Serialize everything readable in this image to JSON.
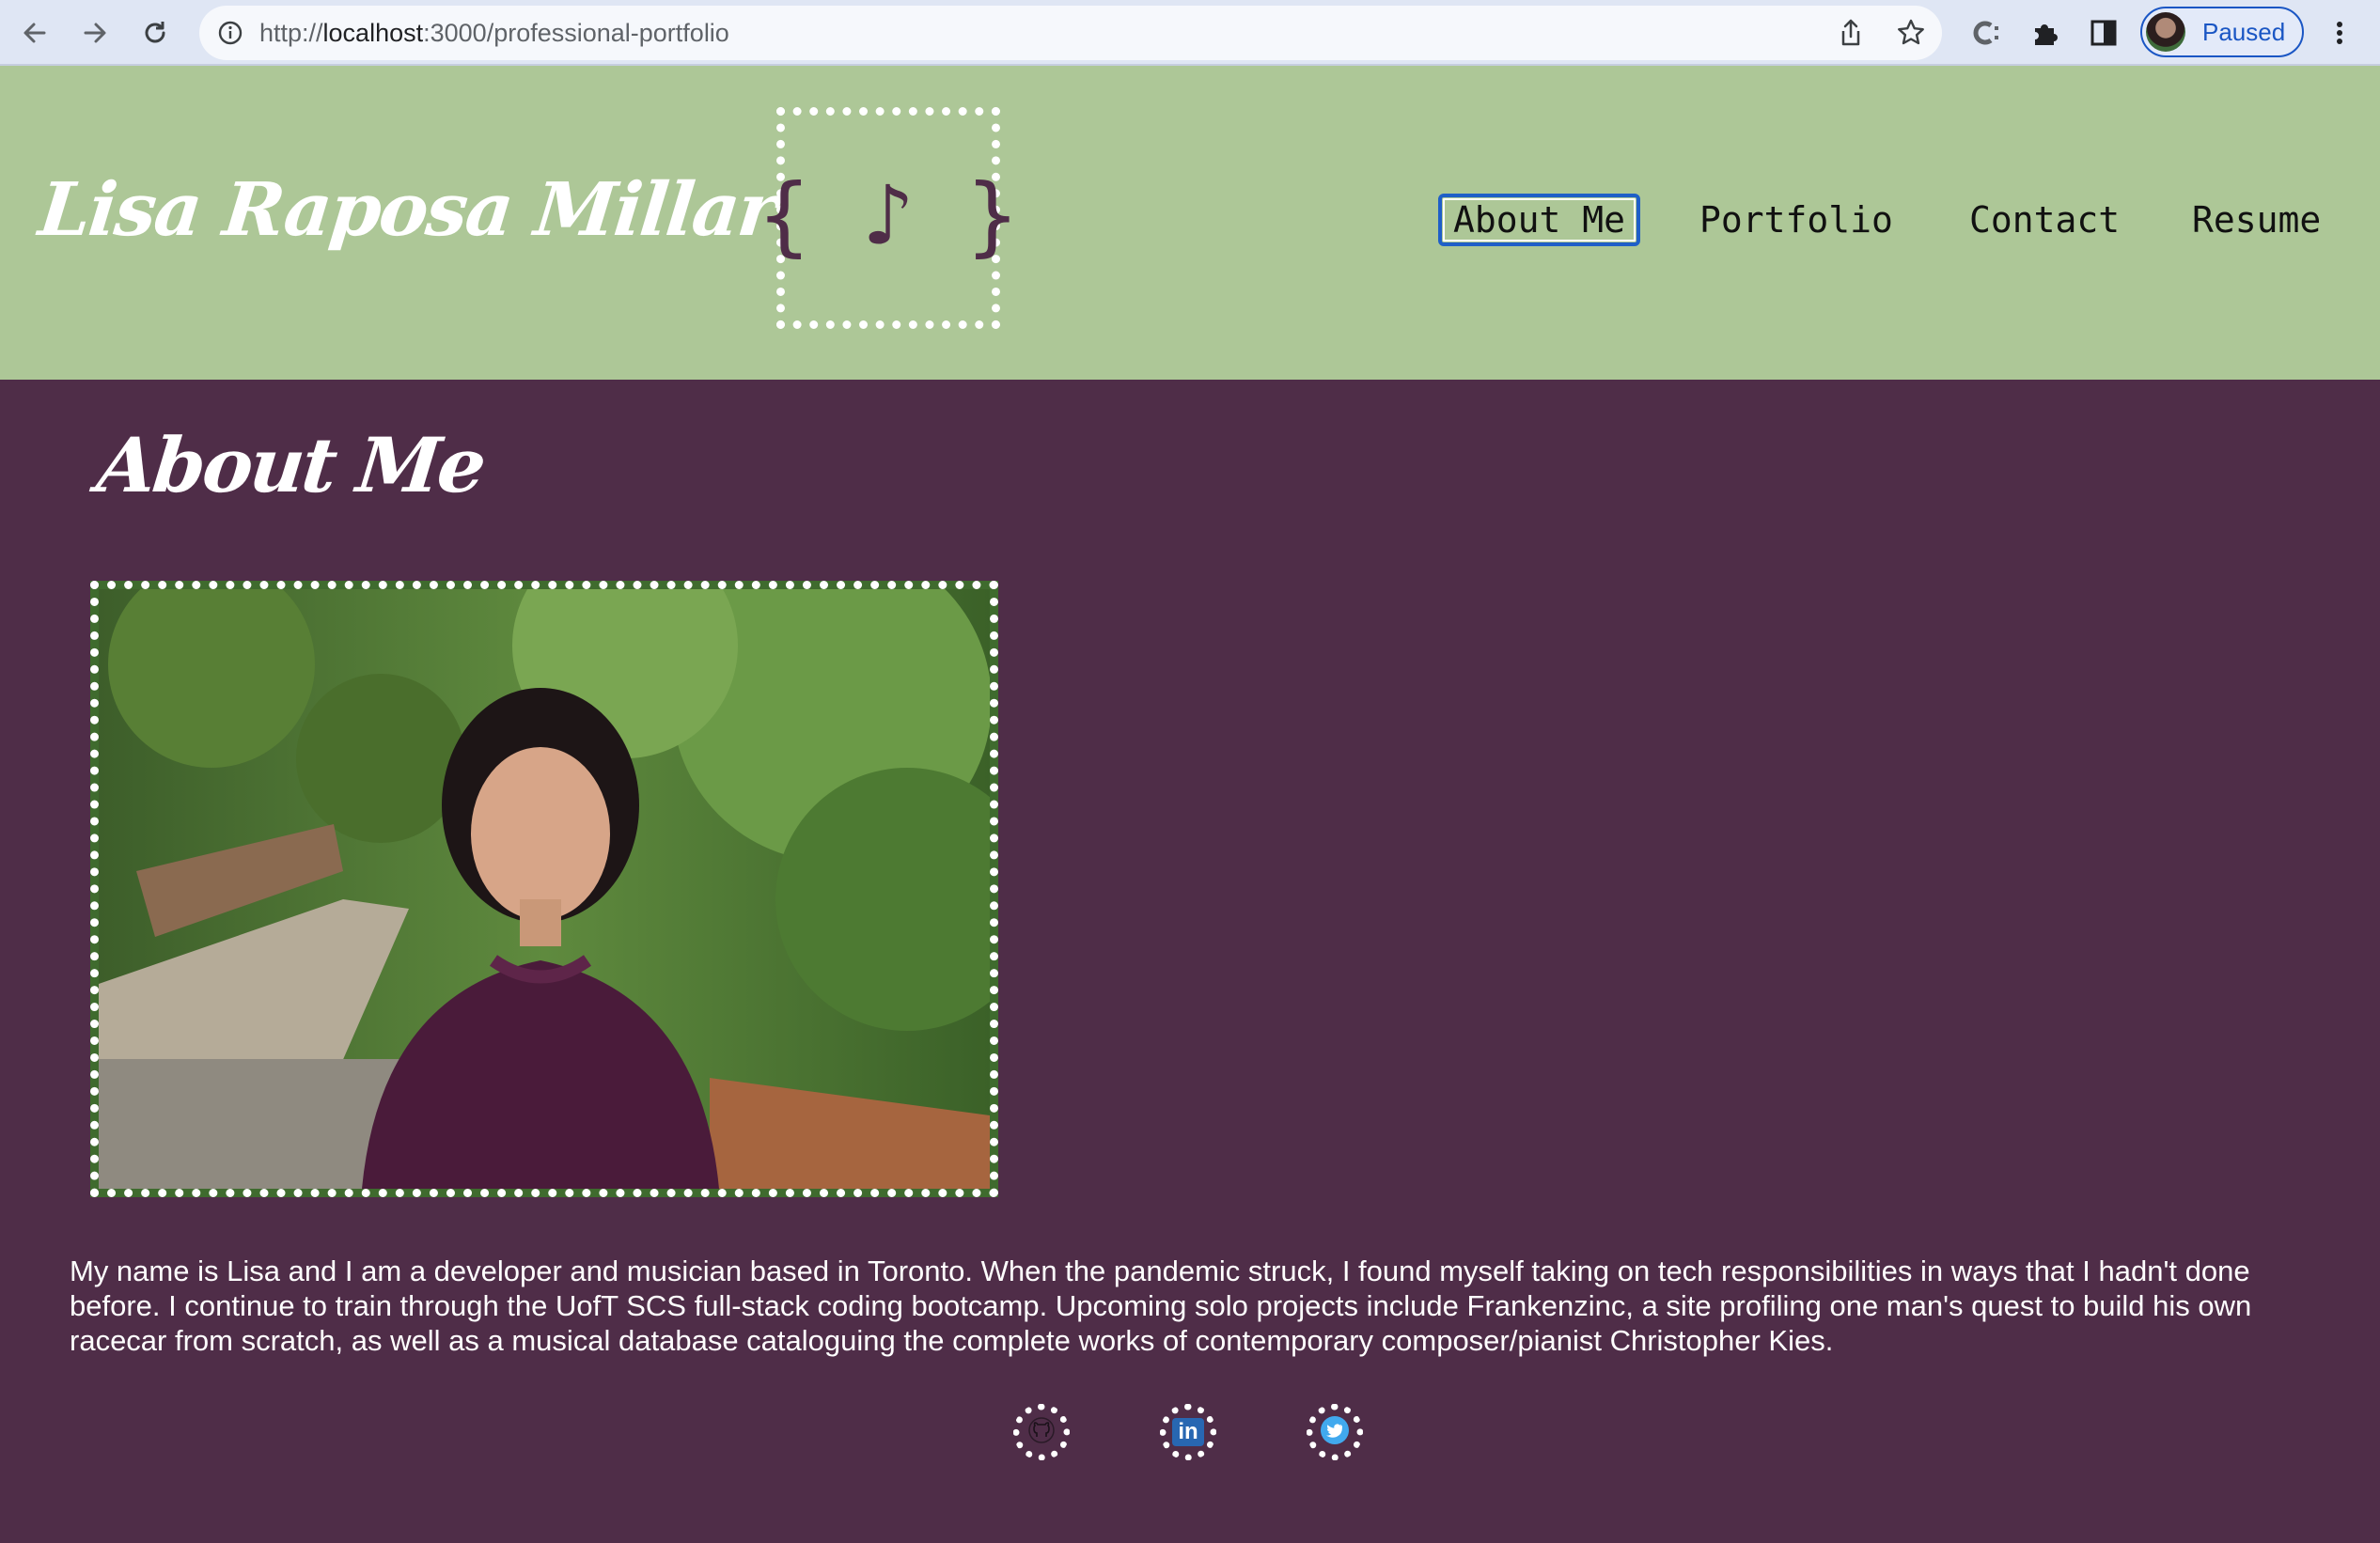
{
  "browser": {
    "url_prefix": "http://",
    "url_host": "localhost",
    "url_path": ":3000/professional-portfolio",
    "profile_label": "Paused",
    "icons": [
      "back-arrow-icon",
      "forward-arrow-icon",
      "reload-icon",
      "site-info-icon",
      "share-icon",
      "bookmark-star-icon",
      "extension-c-icon",
      "puzzle-extensions-icon",
      "side-panel-icon",
      "kebab-menu-icon"
    ]
  },
  "header": {
    "site_name": "Lisa Raposa Millar",
    "logo_glyph": "{ ♪ }",
    "nav": [
      {
        "label": "About Me",
        "active": true
      },
      {
        "label": "Portfolio",
        "active": false
      },
      {
        "label": "Contact",
        "active": false
      },
      {
        "label": "Resume",
        "active": false
      }
    ]
  },
  "main": {
    "heading": "About Me",
    "bio": "My name is Lisa and I am a developer and musician based in Toronto. When the pandemic struck, I found myself taking on tech responsibilities in ways that I hadn't done before. I continue to train through the UofT SCS full-stack coding bootcamp. Upcoming solo projects include Frankenzinc, a site profiling one man's quest to build his own racecar from scratch, as well as a musical database cataloguing the complete works of contemporary composer/pianist Christopher Kies.",
    "social_links": [
      {
        "name": "github",
        "icon": "github-icon"
      },
      {
        "name": "linkedin",
        "icon": "linkedin-icon",
        "text": "in"
      },
      {
        "name": "twitter",
        "icon": "twitter-icon"
      }
    ]
  },
  "colors": {
    "header_bg": "#adc797",
    "page_bg": "#4f2d48",
    "text_light": "#ffffff",
    "active_nav_border": "#1f5fc8"
  }
}
